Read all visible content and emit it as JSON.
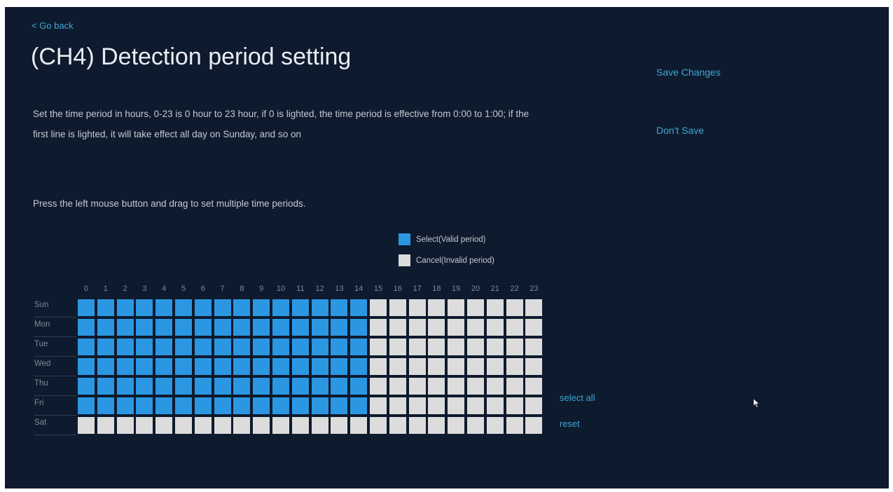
{
  "header": {
    "back_label": "< Go back",
    "title": "(CH4)  Detection period setting"
  },
  "description": "Set the time period in hours, 0-23 is 0 hour to 23 hour, if 0 is lighted, the time period is effective from 0:00 to 1:00; if the first line is lighted, it will take effect all day on Sunday, and so on",
  "instruction": "Press the left mouse button and drag to set multiple time periods.",
  "actions": {
    "save_label": "Save Changes",
    "dont_save_label": "Don't Save",
    "select_all_label": "select all",
    "reset_label": "reset"
  },
  "legend": {
    "select_label": "Select(Valid period)",
    "cancel_label": "Cancel(Invalid period)"
  },
  "colors": {
    "background": "#0e1a2d",
    "selected": "#2b97e3",
    "unselected": "#dcdcdc",
    "accent": "#3fa7d6"
  },
  "schedule": {
    "hours": [
      "0",
      "1",
      "2",
      "3",
      "4",
      "5",
      "6",
      "7",
      "8",
      "9",
      "10",
      "11",
      "12",
      "13",
      "14",
      "15",
      "16",
      "17",
      "18",
      "19",
      "20",
      "21",
      "22",
      "23"
    ],
    "days": [
      "Sun",
      "Mon",
      "Tue",
      "Wed",
      "Thu",
      "Fri",
      "Sat"
    ],
    "grid": [
      [
        1,
        1,
        1,
        1,
        1,
        1,
        1,
        1,
        1,
        1,
        1,
        1,
        1,
        1,
        1,
        0,
        0,
        0,
        0,
        0,
        0,
        0,
        0,
        0
      ],
      [
        1,
        1,
        1,
        1,
        1,
        1,
        1,
        1,
        1,
        1,
        1,
        1,
        1,
        1,
        1,
        0,
        0,
        0,
        0,
        0,
        0,
        0,
        0,
        0
      ],
      [
        1,
        1,
        1,
        1,
        1,
        1,
        1,
        1,
        1,
        1,
        1,
        1,
        1,
        1,
        1,
        0,
        0,
        0,
        0,
        0,
        0,
        0,
        0,
        0
      ],
      [
        1,
        1,
        1,
        1,
        1,
        1,
        1,
        1,
        1,
        1,
        1,
        1,
        1,
        1,
        1,
        0,
        0,
        0,
        0,
        0,
        0,
        0,
        0,
        0
      ],
      [
        1,
        1,
        1,
        1,
        1,
        1,
        1,
        1,
        1,
        1,
        1,
        1,
        1,
        1,
        1,
        0,
        0,
        0,
        0,
        0,
        0,
        0,
        0,
        0
      ],
      [
        1,
        1,
        1,
        1,
        1,
        1,
        1,
        1,
        1,
        1,
        1,
        1,
        1,
        1,
        1,
        0,
        0,
        0,
        0,
        0,
        0,
        0,
        0,
        0
      ],
      [
        0,
        0,
        0,
        0,
        0,
        0,
        0,
        0,
        0,
        0,
        0,
        0,
        0,
        0,
        0,
        0,
        0,
        0,
        0,
        0,
        0,
        0,
        0,
        0
      ]
    ]
  }
}
